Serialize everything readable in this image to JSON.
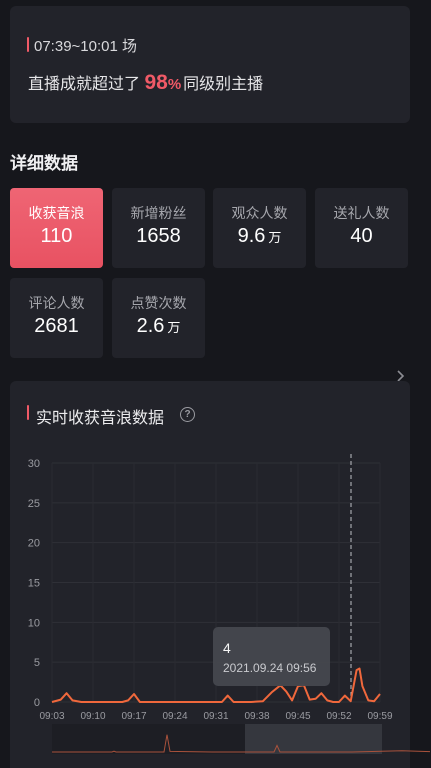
{
  "summary": {
    "time_range": "07:39~10:01 场",
    "text_before": "直播成就超过了",
    "percent_number": "98",
    "percent_sign": "%",
    "text_after": "同级别主播"
  },
  "details": {
    "section_title": "详细数据",
    "stats": [
      {
        "label": "收获音浪",
        "value": "110",
        "unit": "",
        "active": true
      },
      {
        "label": "新增粉丝",
        "value": "1658",
        "unit": ""
      },
      {
        "label": "观众人数",
        "value": "9.6",
        "unit": "万"
      },
      {
        "label": "送礼人数",
        "value": "40",
        "unit": ""
      },
      {
        "label": "评论人数",
        "value": "2681",
        "unit": ""
      },
      {
        "label": "点赞次数",
        "value": "2.6",
        "unit": "万"
      }
    ]
  },
  "icons": {
    "chevron": "chevron-right-icon",
    "help": "question-circle-icon"
  },
  "colors": {
    "accent": "#f05a67",
    "line": "#f0683c",
    "card": "#22232a",
    "background": "#16171c"
  },
  "chart": {
    "title": "实时收获音浪数据",
    "help_glyph": "?",
    "tooltip": {
      "value": "4",
      "time": "2021.09.24 09:56"
    }
  },
  "chart_data": {
    "type": "line",
    "title": "实时收获音浪数据",
    "xlabel": "",
    "ylabel": "",
    "x_ticks": [
      "09:03",
      "09:10",
      "09:17",
      "09:24",
      "09:31",
      "09:38",
      "09:45",
      "09:52",
      "09:59"
    ],
    "y_ticks": [
      0,
      5,
      10,
      15,
      20,
      25,
      30
    ],
    "ylim": [
      0,
      30
    ],
    "xlim_minutes": [
      0,
      56
    ],
    "grid": true,
    "series": [
      {
        "minutes": [
          0,
          1.5,
          2.5,
          3.5,
          5,
          12,
          13,
          14,
          15,
          20,
          26,
          29,
          30,
          31,
          34,
          36,
          37.5,
          39,
          40,
          41,
          42,
          43,
          44,
          45,
          46,
          47,
          48,
          49,
          50,
          51,
          52,
          52.5,
          53,
          54,
          55,
          56
        ],
        "values": [
          0,
          0.3,
          1.1,
          0.2,
          0,
          0,
          0.2,
          1,
          0,
          0,
          0,
          0,
          0.8,
          0,
          0,
          0.1,
          1.2,
          2.1,
          1.3,
          0.2,
          2,
          2.1,
          0.3,
          0.4,
          1.1,
          0.2,
          0,
          0,
          0.8,
          0.1,
          4,
          4.2,
          2,
          0.2,
          0.1,
          1
        ]
      }
    ],
    "highlight": {
      "x_label": "09:56",
      "value": 4
    }
  }
}
